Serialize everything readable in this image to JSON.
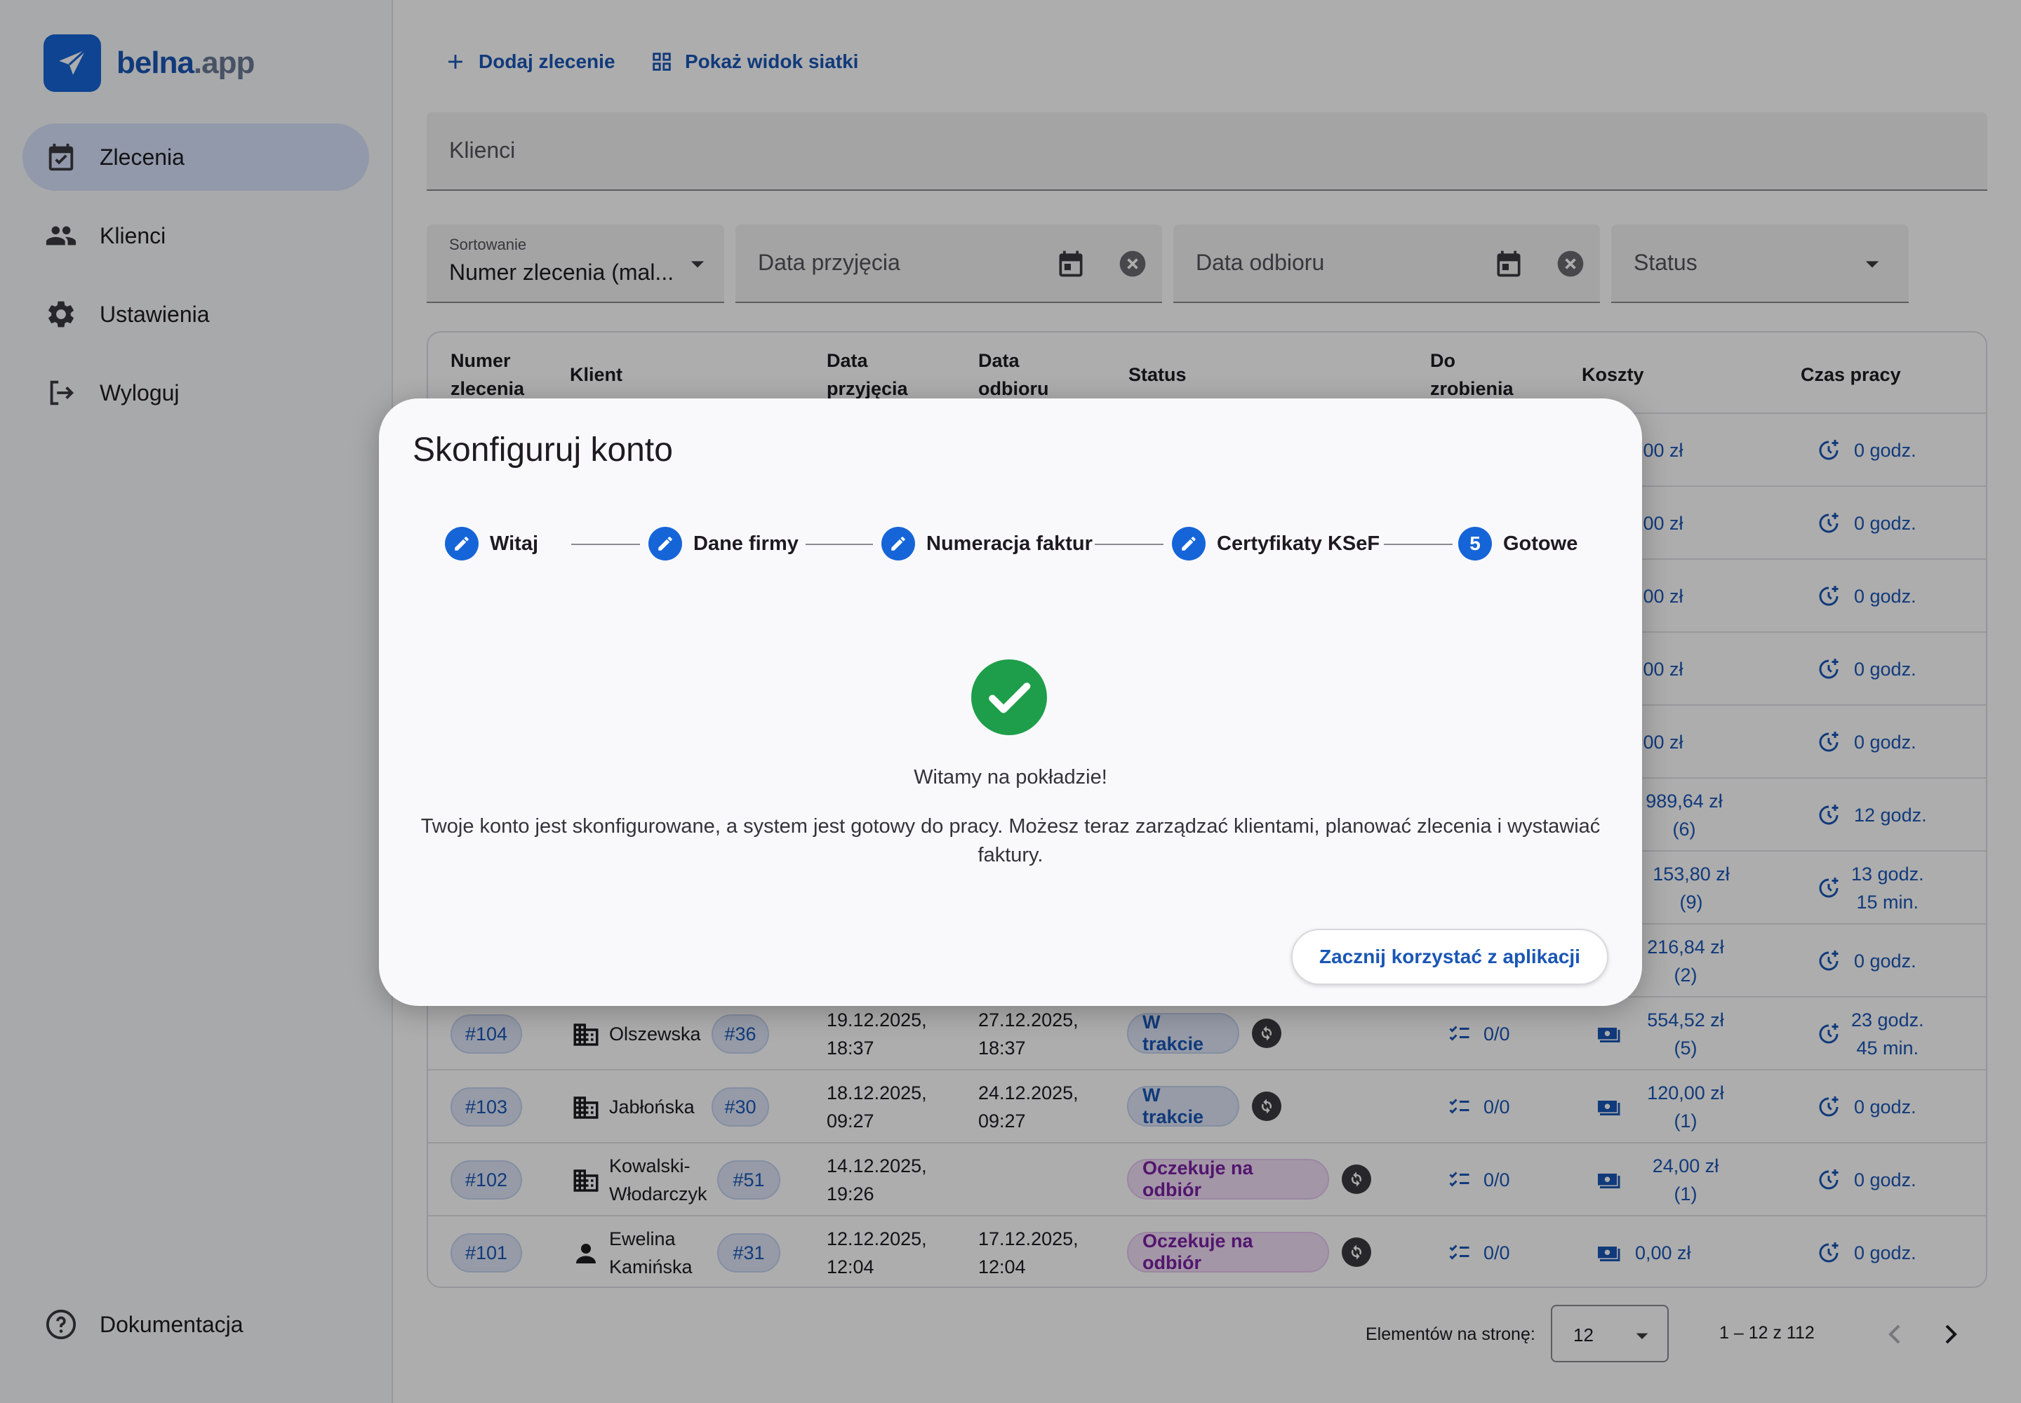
{
  "app": {
    "logo_main": "belna",
    "logo_suffix": ".app"
  },
  "sidebar": {
    "items": [
      {
        "label": "Zlecenia",
        "icon": "calendar-check-icon",
        "active": true
      },
      {
        "label": "Klienci",
        "icon": "people-icon"
      },
      {
        "label": "Ustawienia",
        "icon": "gear-icon"
      },
      {
        "label": "Wyloguj",
        "icon": "logout-icon"
      }
    ],
    "bottom": {
      "label": "Dokumentacja",
      "icon": "help-circle-icon"
    }
  },
  "toolbar": {
    "add_label": "Dodaj zlecenie",
    "grid_label": "Pokaż widok siatki"
  },
  "filters": {
    "clients_placeholder": "Klienci",
    "sort_label": "Sortowanie",
    "sort_value": "Numer zlecenia (mal...",
    "received_placeholder": "Data przyjęcia",
    "pickup_placeholder": "Data odbioru",
    "status_placeholder": "Status"
  },
  "table": {
    "headers": {
      "number": [
        "Numer",
        "zlecenia"
      ],
      "client": "Klient",
      "received": [
        "Data",
        "przyjęcia"
      ],
      "pickup": [
        "Data",
        "odbioru"
      ],
      "status": "Status",
      "todo": [
        "Do",
        "zrobienia"
      ],
      "costs": "Koszty",
      "worktime": "Czas pracy"
    },
    "visible_right_rows": [
      {
        "cost": ",00 zł",
        "time": "0 godz."
      },
      {
        "cost": ",00 zł",
        "time": "0 godz."
      },
      {
        "cost": ",00 zł",
        "time": "0 godz."
      },
      {
        "cost": ",00 zł",
        "time": "0 godz."
      },
      {
        "cost": ",00 zł",
        "time": "0 godz."
      },
      {
        "cost": "989,64 zł",
        "cost2": "(6)",
        "time": "12 godz."
      },
      {
        "cost": "153,80 zł",
        "cost2": "(9)",
        "time": "13 godz.",
        "time2": "15 min."
      },
      {
        "cost": "216,84 zł",
        "cost2": "(2)",
        "time": "0 godz."
      }
    ],
    "rows": [
      {
        "number": "#104",
        "client_type": "company",
        "client": [
          "Olszewska"
        ],
        "client_id": "#36",
        "received": [
          "19.12.2025,",
          "18:37"
        ],
        "pickup": [
          "27.12.2025,",
          "18:37"
        ],
        "status": "W trakcie",
        "status_kind": "prog",
        "todo": "0/0",
        "cost": "554,52 zł",
        "cost2": "(5)",
        "time": "23 godz.",
        "time2": "45 min."
      },
      {
        "number": "#103",
        "client_type": "company",
        "client": [
          "Jabłońska"
        ],
        "client_id": "#30",
        "received": [
          "18.12.2025,",
          "09:27"
        ],
        "pickup": [
          "24.12.2025,",
          "09:27"
        ],
        "status": "W trakcie",
        "status_kind": "prog",
        "todo": "0/0",
        "cost": "120,00 zł",
        "cost2": "(1)",
        "time": "0 godz."
      },
      {
        "number": "#102",
        "client_type": "company",
        "client": [
          "Kowalski-",
          "Włodarczyk"
        ],
        "client_id": "#51",
        "received": [
          "14.12.2025,",
          "19:26"
        ],
        "pickup": [
          "",
          ""
        ],
        "status": "Oczekuje na odbiór",
        "status_kind": "wait",
        "todo": "0/0",
        "cost": "24,00 zł",
        "cost2": "(1)",
        "time": "0 godz."
      },
      {
        "number": "#101",
        "client_type": "person",
        "client": [
          "Ewelina",
          "Kamińska"
        ],
        "client_id": "#31",
        "received": [
          "12.12.2025,",
          "12:04"
        ],
        "pickup": [
          "17.12.2025,",
          "12:04"
        ],
        "status": "Oczekuje na odbiór",
        "status_kind": "wait",
        "todo": "0/0",
        "cost": "0,00 zł",
        "time": "0 godz."
      }
    ]
  },
  "paginator": {
    "label": "Elementów na stronę:",
    "per_page": "12",
    "range": "1 – 12 z 112"
  },
  "dialog": {
    "title": "Skonfiguruj konto",
    "steps": [
      {
        "label": "Witaj",
        "state": "edit"
      },
      {
        "label": "Dane firmy",
        "state": "edit"
      },
      {
        "label": "Numeracja faktur",
        "state": "edit"
      },
      {
        "label": "Certyfikaty KSeF",
        "state": "edit"
      },
      {
        "label": "Gotowe",
        "state": "current",
        "number": "5"
      }
    ],
    "heading": "Witamy na pokładzie!",
    "body_line1": "Twoje konto jest skonfigurowane, a system jest gotowy do pracy. Możesz teraz zarządzać klientami, planować zlecenia i wystawiać",
    "body_line2": "faktury.",
    "button": "Zacznij korzystać z aplikacji"
  },
  "colors": {
    "primary": "#1565d8",
    "success": "#1e9e4a",
    "waiting": "#7b1fa2"
  }
}
